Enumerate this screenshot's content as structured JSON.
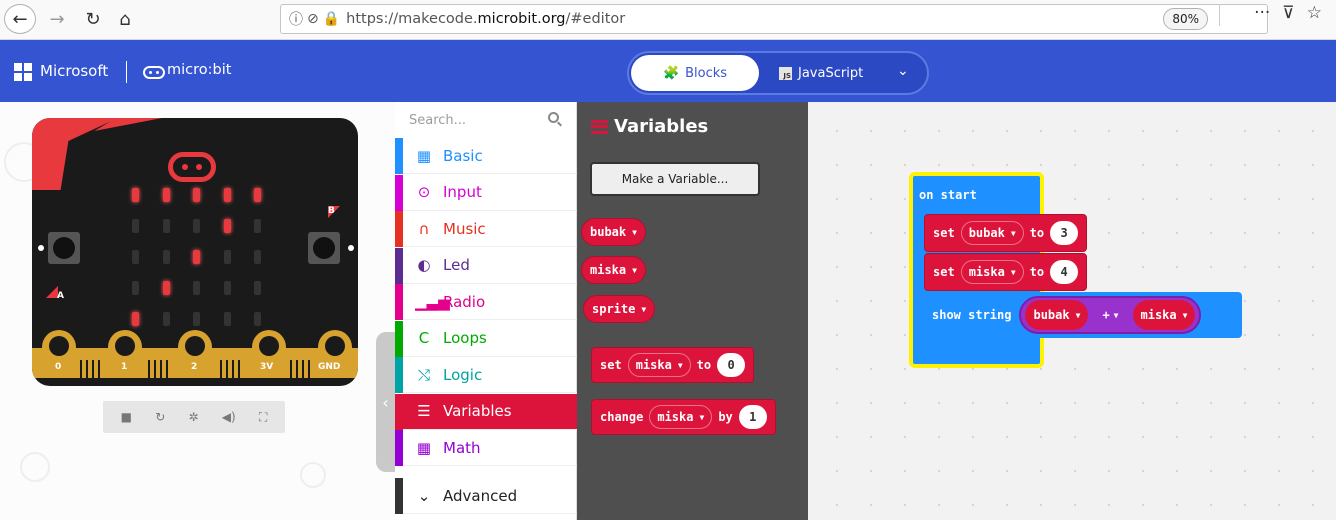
{
  "browser": {
    "url_prefix": "https://makecode.",
    "url_domain": "microbit.org",
    "url_suffix": "/#editor",
    "zoom": "80%"
  },
  "header": {
    "brand_ms": "Microsoft",
    "brand_mb": "micro:bit",
    "tab_blocks": "Blocks",
    "tab_js": "JavaScript",
    "js_icon_text": "JS"
  },
  "simulator": {
    "pins": [
      "0",
      "1",
      "2",
      "3V",
      "GND"
    ],
    "button_a": "A",
    "button_b": "B",
    "leds_on": [
      [
        1,
        0
      ],
      [
        1,
        1
      ],
      [
        1,
        2
      ],
      [
        1,
        3
      ],
      [
        1,
        4
      ],
      [
        2,
        3
      ],
      [
        3,
        2
      ],
      [
        4,
        1
      ],
      [
        5,
        0
      ]
    ]
  },
  "toolbox": {
    "search_placeholder": "Search...",
    "categories": [
      {
        "label": "Basic",
        "color": "#1e90ff",
        "icon": "grid-icon"
      },
      {
        "label": "Input",
        "color": "#d400d4",
        "icon": "target-icon"
      },
      {
        "label": "Music",
        "color": "#e63022",
        "icon": "headphones-icon"
      },
      {
        "label": "Led",
        "color": "#5c2d91",
        "icon": "toggle-icon"
      },
      {
        "label": "Radio",
        "color": "#e3008c",
        "icon": "signal-icon"
      },
      {
        "label": "Loops",
        "color": "#00aa00",
        "icon": "loop-icon"
      },
      {
        "label": "Logic",
        "color": "#00a4a6",
        "icon": "shuffle-icon"
      },
      {
        "label": "Variables",
        "color": "#dc143c",
        "icon": "list-icon"
      },
      {
        "label": "Math",
        "color": "#9400d3",
        "icon": "calculator-icon"
      },
      {
        "label": "Advanced",
        "color": "#333333",
        "icon": "chevron-down-icon"
      }
    ]
  },
  "flyout": {
    "title": "Variables",
    "make_variable": "Make a Variable...",
    "variables": [
      "bubak",
      "miska",
      "sprite"
    ],
    "set_block": {
      "keyword": "set",
      "var": "miska",
      "to": "to",
      "value": "0"
    },
    "change_block": {
      "keyword": "change",
      "var": "miska",
      "by": "by",
      "value": "1"
    }
  },
  "workspace": {
    "on_start": "on start",
    "stmt1": {
      "keyword": "set",
      "var": "bubak",
      "to": "to",
      "value": "3"
    },
    "stmt2": {
      "keyword": "set",
      "var": "miska",
      "to": "to",
      "value": "4"
    },
    "show": {
      "keyword": "show string",
      "left": "bubak",
      "op": "+",
      "right": "miska"
    }
  },
  "colors": {
    "header": "#3454d1",
    "variables": "#dc143c",
    "basic": "#1e90ff",
    "flyout_bg": "#4f4f4f",
    "workspace_bg": "#f2f2f2",
    "math_expr": "#9932cc"
  }
}
